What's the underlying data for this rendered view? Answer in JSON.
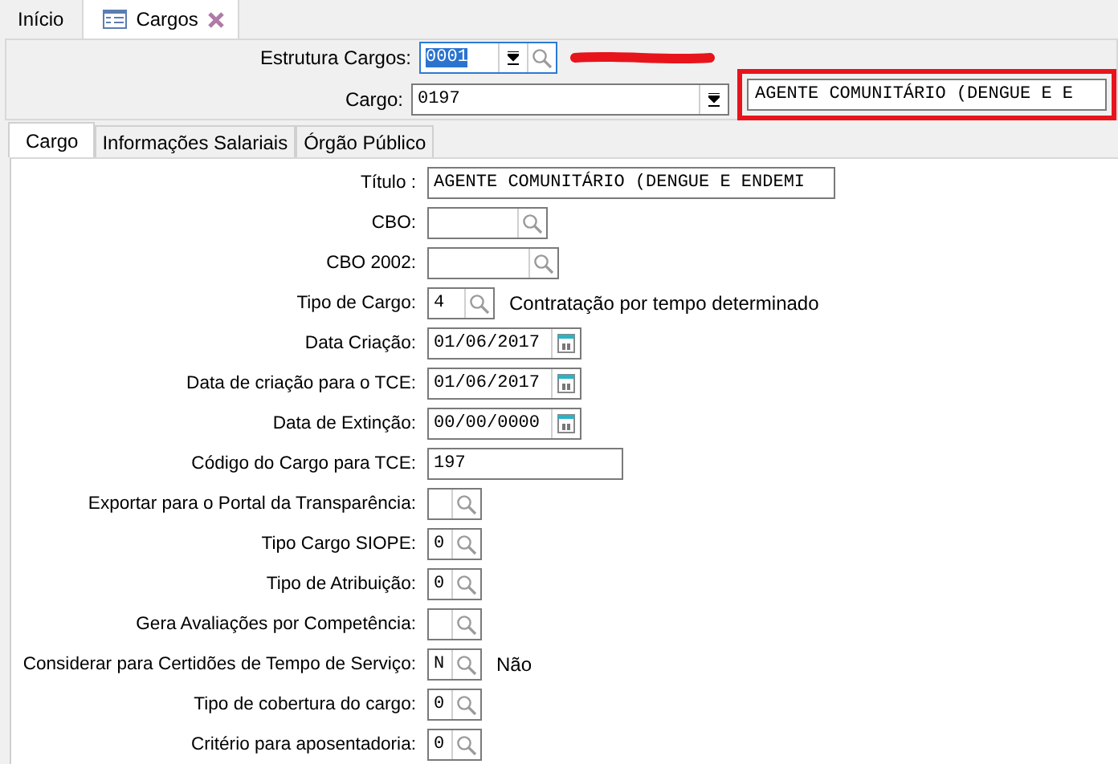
{
  "tabs": [
    {
      "label": "Início",
      "selected": false,
      "closable": false
    },
    {
      "label": "Cargos",
      "selected": true,
      "closable": true
    }
  ],
  "header": {
    "estrutura": {
      "label": "Estrutura Cargos:",
      "value": "0001",
      "focused": true
    },
    "cargo": {
      "label": "Cargo:",
      "value": "0197",
      "description": "AGENTE COMUNITÁRIO (DENGUE E E"
    }
  },
  "inner_tabs": [
    {
      "label": "Cargo",
      "selected": true
    },
    {
      "label": "Informações Salariais",
      "selected": false
    },
    {
      "label": "Órgão Público",
      "selected": false
    }
  ],
  "rows": [
    {
      "label": "Título :",
      "kind": "text",
      "value": "AGENTE COMUNITÁRIO (DENGUE E ENDEMI"
    },
    {
      "label": "CBO:",
      "kind": "lookup"
    },
    {
      "label": "CBO 2002:",
      "kind": "lookup"
    },
    {
      "label": "Tipo de Cargo:",
      "kind": "lookup",
      "value": "4",
      "description": "Contratação por tempo determinado"
    },
    {
      "label": "Data Criação:",
      "kind": "date",
      "value": "01/06/2017"
    },
    {
      "label": "Data de criação para o TCE:",
      "kind": "date",
      "value": "01/06/2017"
    },
    {
      "label": "Data de Extinção:",
      "kind": "date",
      "value": "00/00/0000"
    },
    {
      "label": "Código do Cargo para TCE:",
      "kind": "text",
      "value": "197"
    },
    {
      "label": "Exportar para o Portal da Transparência:",
      "kind": "lookup"
    },
    {
      "label": "Tipo Cargo SIOPE:",
      "kind": "lookup",
      "value": "0"
    },
    {
      "label": "Tipo de Atribuição:",
      "kind": "lookup",
      "value": "0"
    },
    {
      "label": "Gera Avaliações por Competência:",
      "kind": "lookup"
    },
    {
      "label": "Considerar para Certidões de Tempo de Serviço:",
      "kind": "lookup",
      "value": "N",
      "description": "Não"
    },
    {
      "label": "Tipo de cobertura do cargo:",
      "kind": "lookup",
      "value": "0"
    },
    {
      "label": "Critério para aposentadoria:",
      "kind": "lookup",
      "value": "0"
    }
  ]
}
